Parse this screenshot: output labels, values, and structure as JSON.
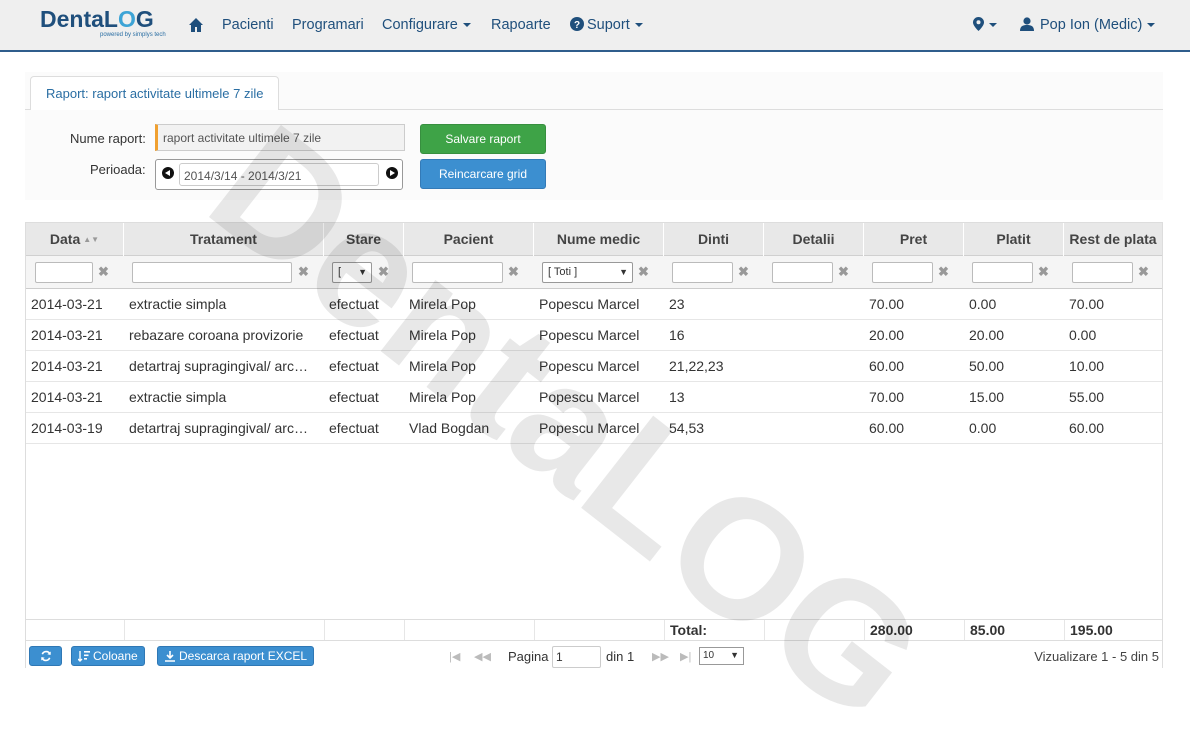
{
  "navbar": {
    "logo_main_a": "Denta",
    "logo_main_b": "L",
    "logo_main_c": "O",
    "logo_main_d": "G",
    "logo_sub": "powered by simplys tech",
    "items": [
      "Pacienti",
      "Programari",
      "Configurare",
      "Rapoarte",
      "Suport"
    ],
    "user": "Pop Ion (Medic)"
  },
  "report": {
    "tab_label": "Raport: raport activitate ultimele 7 zile",
    "name_label": "Nume raport:",
    "name_value": "raport activitate ultimele 7 zile",
    "period_label": "Perioada:",
    "period_value": "2014/3/14 - 2014/3/21",
    "save_label": "Salvare raport",
    "reload_label": "Reincarcare grid"
  },
  "grid": {
    "headers": [
      "Data",
      "Tratament",
      "Stare",
      "Pacient",
      "Nume medic",
      "Dinti",
      "Detalii",
      "Pret",
      "Platit",
      "Rest de plata"
    ],
    "filters": {
      "stare": "[",
      "medic": "[ Toti ]"
    },
    "rows": [
      [
        "2014-03-21",
        "extractie simpla",
        "efectuat",
        "Mirela Pop",
        "Popescu Marcel",
        "23",
        "",
        "70.00",
        "0.00",
        "70.00"
      ],
      [
        "2014-03-21",
        "rebazare coroana provizorie",
        "efectuat",
        "Mirela Pop",
        "Popescu Marcel",
        "16",
        "",
        "20.00",
        "20.00",
        "0.00"
      ],
      [
        "2014-03-21",
        "detartraj supragingival/ arc…",
        "efectuat",
        "Mirela Pop",
        "Popescu Marcel",
        "21,22,23",
        "",
        "60.00",
        "50.00",
        "10.00"
      ],
      [
        "2014-03-21",
        "extractie simpla",
        "efectuat",
        "Mirela Pop",
        "Popescu Marcel",
        "13",
        "",
        "70.00",
        "15.00",
        "55.00"
      ],
      [
        "2014-03-19",
        "detartraj supragingival/ arc…",
        "efectuat",
        "Vlad Bogdan",
        "Popescu Marcel",
        "54,53",
        "",
        "60.00",
        "0.00",
        "60.00"
      ]
    ],
    "totals": {
      "label": "Total:",
      "pret": "280.00",
      "platit": "85.00",
      "rest": "195.00"
    }
  },
  "pager": {
    "columns_label": "Coloane",
    "excel_label": "Descarca raport EXCEL",
    "page_label": "Pagina",
    "page_value": "1",
    "of_label": "din 1",
    "page_size": "10",
    "view_label": "Vizualizare 1 - 5 din 5"
  },
  "watermark": "DentaLOG"
}
